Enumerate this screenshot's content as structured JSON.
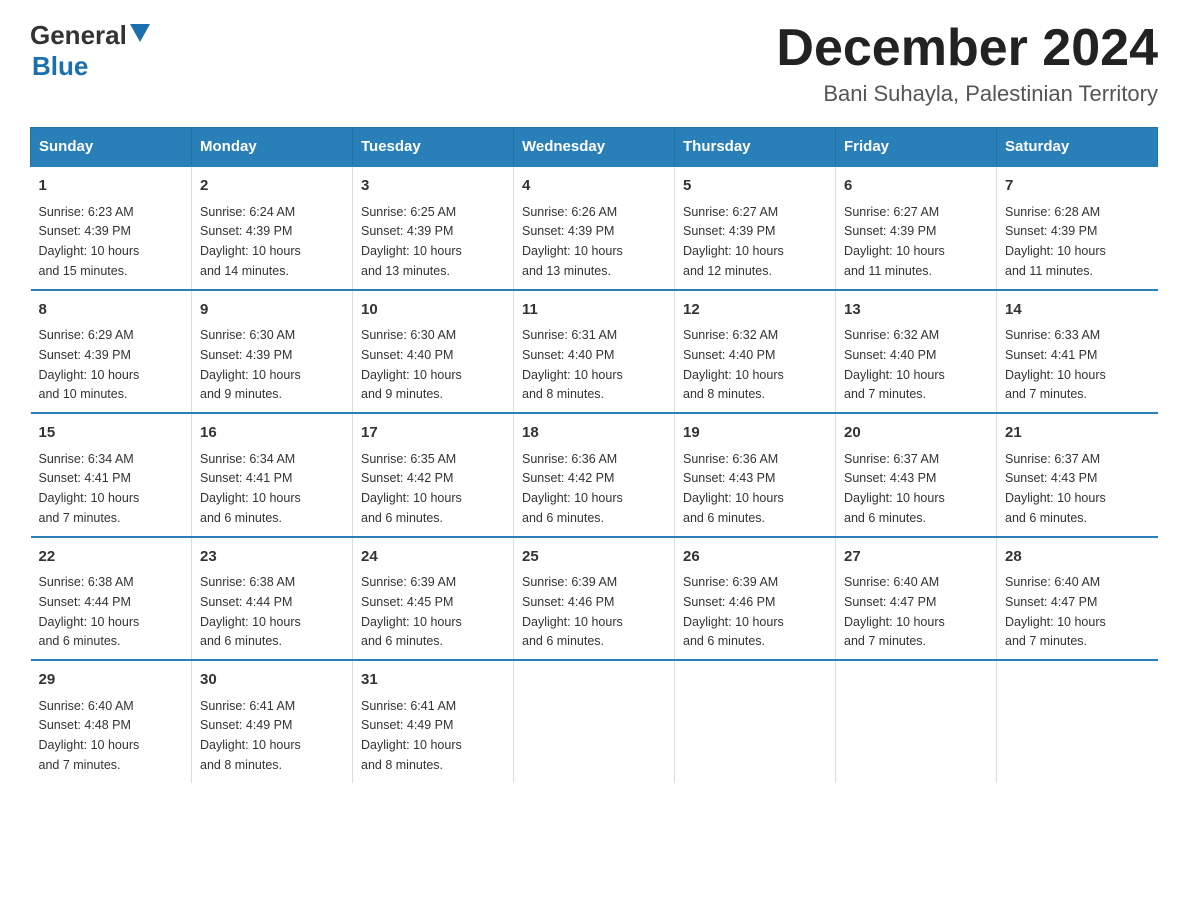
{
  "header": {
    "logo_general": "General",
    "logo_blue": "Blue",
    "month_title": "December 2024",
    "subtitle": "Bani Suhayla, Palestinian Territory"
  },
  "days_of_week": [
    "Sunday",
    "Monday",
    "Tuesday",
    "Wednesday",
    "Thursday",
    "Friday",
    "Saturday"
  ],
  "weeks": [
    [
      {
        "day": "1",
        "sunrise": "6:23 AM",
        "sunset": "4:39 PM",
        "daylight": "10 hours and 15 minutes."
      },
      {
        "day": "2",
        "sunrise": "6:24 AM",
        "sunset": "4:39 PM",
        "daylight": "10 hours and 14 minutes."
      },
      {
        "day": "3",
        "sunrise": "6:25 AM",
        "sunset": "4:39 PM",
        "daylight": "10 hours and 13 minutes."
      },
      {
        "day": "4",
        "sunrise": "6:26 AM",
        "sunset": "4:39 PM",
        "daylight": "10 hours and 13 minutes."
      },
      {
        "day": "5",
        "sunrise": "6:27 AM",
        "sunset": "4:39 PM",
        "daylight": "10 hours and 12 minutes."
      },
      {
        "day": "6",
        "sunrise": "6:27 AM",
        "sunset": "4:39 PM",
        "daylight": "10 hours and 11 minutes."
      },
      {
        "day": "7",
        "sunrise": "6:28 AM",
        "sunset": "4:39 PM",
        "daylight": "10 hours and 11 minutes."
      }
    ],
    [
      {
        "day": "8",
        "sunrise": "6:29 AM",
        "sunset": "4:39 PM",
        "daylight": "10 hours and 10 minutes."
      },
      {
        "day": "9",
        "sunrise": "6:30 AM",
        "sunset": "4:39 PM",
        "daylight": "10 hours and 9 minutes."
      },
      {
        "day": "10",
        "sunrise": "6:30 AM",
        "sunset": "4:40 PM",
        "daylight": "10 hours and 9 minutes."
      },
      {
        "day": "11",
        "sunrise": "6:31 AM",
        "sunset": "4:40 PM",
        "daylight": "10 hours and 8 minutes."
      },
      {
        "day": "12",
        "sunrise": "6:32 AM",
        "sunset": "4:40 PM",
        "daylight": "10 hours and 8 minutes."
      },
      {
        "day": "13",
        "sunrise": "6:32 AM",
        "sunset": "4:40 PM",
        "daylight": "10 hours and 7 minutes."
      },
      {
        "day": "14",
        "sunrise": "6:33 AM",
        "sunset": "4:41 PM",
        "daylight": "10 hours and 7 minutes."
      }
    ],
    [
      {
        "day": "15",
        "sunrise": "6:34 AM",
        "sunset": "4:41 PM",
        "daylight": "10 hours and 7 minutes."
      },
      {
        "day": "16",
        "sunrise": "6:34 AM",
        "sunset": "4:41 PM",
        "daylight": "10 hours and 6 minutes."
      },
      {
        "day": "17",
        "sunrise": "6:35 AM",
        "sunset": "4:42 PM",
        "daylight": "10 hours and 6 minutes."
      },
      {
        "day": "18",
        "sunrise": "6:36 AM",
        "sunset": "4:42 PM",
        "daylight": "10 hours and 6 minutes."
      },
      {
        "day": "19",
        "sunrise": "6:36 AM",
        "sunset": "4:43 PM",
        "daylight": "10 hours and 6 minutes."
      },
      {
        "day": "20",
        "sunrise": "6:37 AM",
        "sunset": "4:43 PM",
        "daylight": "10 hours and 6 minutes."
      },
      {
        "day": "21",
        "sunrise": "6:37 AM",
        "sunset": "4:43 PM",
        "daylight": "10 hours and 6 minutes."
      }
    ],
    [
      {
        "day": "22",
        "sunrise": "6:38 AM",
        "sunset": "4:44 PM",
        "daylight": "10 hours and 6 minutes."
      },
      {
        "day": "23",
        "sunrise": "6:38 AM",
        "sunset": "4:44 PM",
        "daylight": "10 hours and 6 minutes."
      },
      {
        "day": "24",
        "sunrise": "6:39 AM",
        "sunset": "4:45 PM",
        "daylight": "10 hours and 6 minutes."
      },
      {
        "day": "25",
        "sunrise": "6:39 AM",
        "sunset": "4:46 PM",
        "daylight": "10 hours and 6 minutes."
      },
      {
        "day": "26",
        "sunrise": "6:39 AM",
        "sunset": "4:46 PM",
        "daylight": "10 hours and 6 minutes."
      },
      {
        "day": "27",
        "sunrise": "6:40 AM",
        "sunset": "4:47 PM",
        "daylight": "10 hours and 7 minutes."
      },
      {
        "day": "28",
        "sunrise": "6:40 AM",
        "sunset": "4:47 PM",
        "daylight": "10 hours and 7 minutes."
      }
    ],
    [
      {
        "day": "29",
        "sunrise": "6:40 AM",
        "sunset": "4:48 PM",
        "daylight": "10 hours and 7 minutes."
      },
      {
        "day": "30",
        "sunrise": "6:41 AM",
        "sunset": "4:49 PM",
        "daylight": "10 hours and 8 minutes."
      },
      {
        "day": "31",
        "sunrise": "6:41 AM",
        "sunset": "4:49 PM",
        "daylight": "10 hours and 8 minutes."
      },
      null,
      null,
      null,
      null
    ]
  ],
  "labels": {
    "sunrise": "Sunrise:",
    "sunset": "Sunset:",
    "daylight": "Daylight:"
  }
}
